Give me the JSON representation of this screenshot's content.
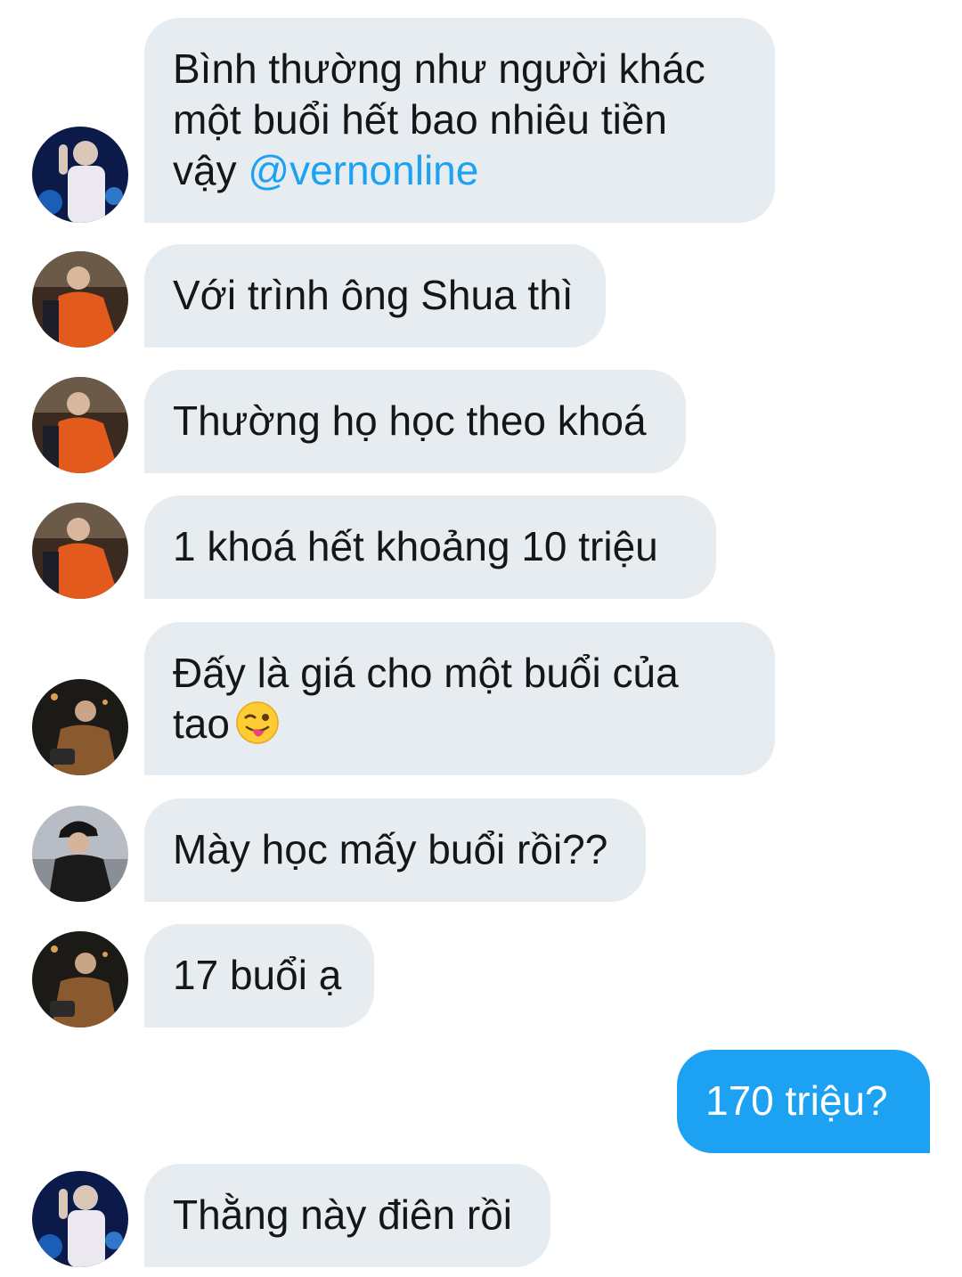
{
  "messages": [
    {
      "direction": "received",
      "avatar": "vernon-avatar-blue",
      "text": "Bình thường như người khác\nmột buổi hết bao nhiêu tiền\nvậy ",
      "mention": "@vernonline"
    },
    {
      "direction": "received",
      "avatar": "joshua-avatar-orange",
      "text": "Với trình ông Shua thì"
    },
    {
      "direction": "received",
      "avatar": "joshua-avatar-orange",
      "text": "Thường họ học theo khoá"
    },
    {
      "direction": "received",
      "avatar": "joshua-avatar-orange",
      "text": "1 khoá hết khoảng 10 triệu"
    },
    {
      "direction": "received",
      "avatar": "user-avatar-night",
      "text": "Đấy là giá cho một buổi của\ntao",
      "emoji": "winking-face-with-tongue"
    },
    {
      "direction": "received",
      "avatar": "user-avatar-black-hat",
      "text": "Mày học mấy buổi rồi??"
    },
    {
      "direction": "received",
      "avatar": "user-avatar-night",
      "text": "17 buổi ạ"
    },
    {
      "direction": "sent",
      "text": "170 triệu?"
    },
    {
      "direction": "received",
      "avatar": "vernon-avatar-blue",
      "text": "Thằng này điên rồi"
    }
  ],
  "colors": {
    "received_bubble": "#e6ecf0",
    "sent_bubble": "#1da1f2",
    "mention": "#1da1f2",
    "text": "#14171a"
  }
}
